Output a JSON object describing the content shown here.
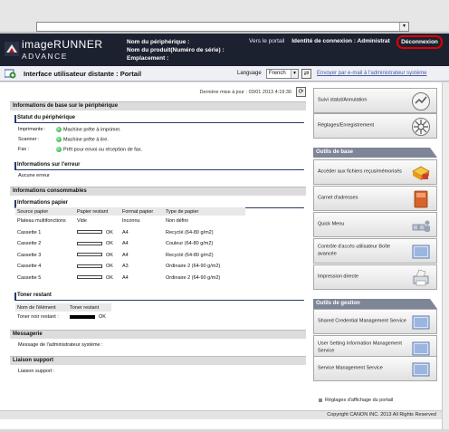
{
  "header": {
    "logo_line1": "imageRUNNER",
    "logo_line2": "ADVANCE",
    "device_name_label": "Nom du périphérique :",
    "product_name_label": "Nom du produit(Numéro de série) :",
    "location_label": "Emplacement :",
    "portal_link": "Vers le portail",
    "login_id": "Identité de connexion : Administrat",
    "logout": "Déconnexion"
  },
  "portalbar": {
    "title": "Interface utilisateur distante : Portail",
    "language_label": "Language",
    "language_value": "French",
    "mail_link": "Envoyer par e-mail à l'administrateur système"
  },
  "main": {
    "last_update": "Dernière mise à jour : 03/01 2013 4:19:30",
    "basic_info_title": "Informations de base sur le périphérique",
    "device_status_title": "Statut du périphérique",
    "status": [
      {
        "label": "Imprimante :",
        "value": "Machine prête à imprimer."
      },
      {
        "label": "Scanner :",
        "value": "Machine prête à lire."
      },
      {
        "label": "Fax :",
        "value": "Prêt pour envoi ou réception de fax."
      }
    ],
    "error_title": "Informations sur l'erreur",
    "error_value": "Aucune erreur",
    "consumables_title": "Informations consommables",
    "paper_title": "Informations papier",
    "paper_headers": [
      "Source papier",
      "Papier restant",
      "Format papier",
      "Type de papier"
    ],
    "paper_rows": [
      {
        "source": "Plateau multifonctions",
        "remaining": "Vide",
        "bar": false,
        "format": "Inconnu",
        "type": "Non défini"
      },
      {
        "source": "Cassette 1",
        "remaining": "OK",
        "bar": true,
        "format": "A4",
        "type": "Recyclé (64-80 g/m2)"
      },
      {
        "source": "Cassette 2",
        "remaining": "OK",
        "bar": true,
        "format": "A4",
        "type": "Couleur (64-80 g/m2)"
      },
      {
        "source": "Cassette 3",
        "remaining": "OK",
        "bar": true,
        "format": "A4",
        "type": "Recyclé (64-80 g/m2)"
      },
      {
        "source": "Cassette 4",
        "remaining": "OK",
        "bar": true,
        "format": "A3",
        "type": "Ordinaire 2 (64-90 g/m2)"
      },
      {
        "source": "Cassette 5",
        "remaining": "OK",
        "bar": true,
        "format": "A4",
        "type": "Ordinaire 2 (64-90 g/m2)"
      }
    ],
    "toner_title": "Toner restant",
    "toner_headers": [
      "Nom de l'élément",
      "Toner restant"
    ],
    "toner_label": "Toner noir restant :",
    "toner_value": "OK",
    "messaging_title": "Messagerie",
    "admin_message_label": "Message de l'administrateur système :",
    "support_title": "Liaison support",
    "support_label": "Liaison support :"
  },
  "right": {
    "top_items": [
      "Suivi statut/Annulation",
      "Réglages/Enregistrement"
    ],
    "basic_tools_title": "Outils de base",
    "basic_tools": [
      "Accéder aux fichiers reçus/mémorisés",
      "Carnet d'adresses",
      "Quick Menu",
      "Contrôle d'accès utilisateur Boîte avancée",
      "Impression directe"
    ],
    "mgmt_tools_title": "Outils de gestion",
    "mgmt_tools": [
      "Shared Credential Management Service",
      "User Setting Information Management Service",
      "Service Management Service"
    ],
    "portal_settings": "Réglages d'affichage du portail"
  },
  "footer": {
    "copyright": "Copyright CANON INC. 2013 All Rights Reserved"
  },
  "colors": {
    "header_bg": "#1c2130",
    "logout_highlight": "#e00000",
    "status_ok": "#1b9a3a",
    "group_header": "#7d8597"
  },
  "icons": [
    "canon-logo-icon",
    "portal-icon",
    "refresh-icon",
    "status-monitor-icon",
    "settings-icon",
    "folder-icon",
    "address-book-icon",
    "quick-menu-icon",
    "access-control-icon",
    "direct-print-icon",
    "service-icon"
  ]
}
